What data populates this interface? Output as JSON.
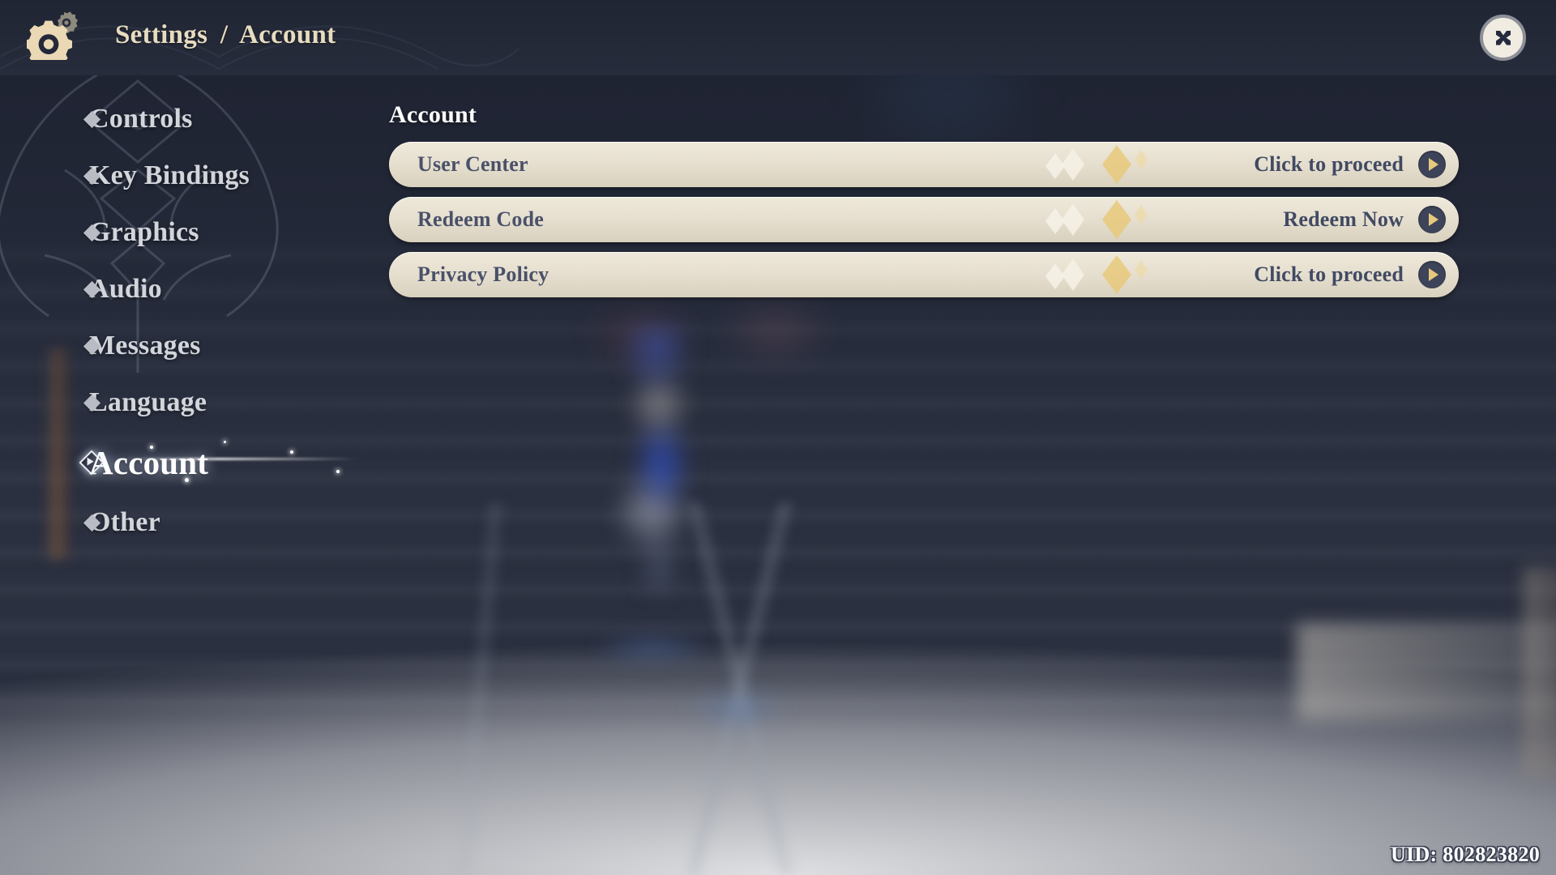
{
  "header": {
    "gear_icon": "gear-icon",
    "breadcrumb_root": "Settings",
    "breadcrumb_separator": "/",
    "breadcrumb_current": "Account",
    "close_icon": "close-icon"
  },
  "sidebar": {
    "items": [
      {
        "label": "Controls",
        "selected": false
      },
      {
        "label": "Key Bindings",
        "selected": false
      },
      {
        "label": "Graphics",
        "selected": false
      },
      {
        "label": "Audio",
        "selected": false
      },
      {
        "label": "Messages",
        "selected": false
      },
      {
        "label": "Language",
        "selected": false
      },
      {
        "label": "Account",
        "selected": true
      },
      {
        "label": "Other",
        "selected": false
      }
    ]
  },
  "main": {
    "section_title": "Account",
    "rows": [
      {
        "label": "User Center",
        "action": "Click to proceed",
        "arrow_icon": "chevron-right-icon"
      },
      {
        "label": "Redeem Code",
        "action": "Redeem Now",
        "arrow_icon": "chevron-right-icon"
      },
      {
        "label": "Privacy Policy",
        "action": "Click to proceed",
        "arrow_icon": "chevron-right-icon"
      }
    ]
  },
  "footer": {
    "uid_text": "UID: 802823820"
  },
  "colors": {
    "header_bg": "#242938",
    "breadcrumb_text": "#e8dcc0",
    "row_bg": "#e6dfcf",
    "row_text": "#4a5169",
    "arrow_circle": "#3d4459",
    "arrow_glyph": "#e6c87e",
    "selected_nav_text": "#ffffff",
    "nav_text": "#d2d5da",
    "sparkle_gold": "#e8c97b"
  }
}
